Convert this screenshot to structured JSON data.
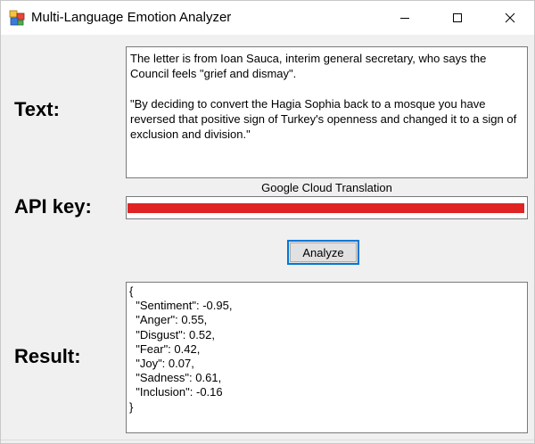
{
  "window": {
    "title": "Multi-Language Emotion Analyzer",
    "minimize_icon": "minimize-icon",
    "maximize_icon": "maximize-icon",
    "close_icon": "close-icon"
  },
  "labels": {
    "text": "Text:",
    "api_key": "API key:",
    "result": "Result:"
  },
  "input_text": {
    "value": "The letter is from Ioan Sauca, interim general secretary, who says the Council feels \"grief and dismay\".\n\n\"By deciding to convert the Hagia Sophia back to a mosque you have reversed that positive sign of Turkey's openness and changed it to a sign of exclusion and division.\""
  },
  "api": {
    "service_label": "Google Cloud Translation",
    "redaction_color": "#e02424"
  },
  "buttons": {
    "analyze": "Analyze"
  },
  "result": {
    "value": "{\n  \"Sentiment\": -0.95,\n  \"Anger\": 0.55,\n  \"Disgust\": 0.52,\n  \"Fear\": 0.42,\n  \"Joy\": 0.07,\n  \"Sadness\": 0.61,\n  \"Inclusion\": -0.16\n}"
  },
  "colors": {
    "accent": "#0078d7",
    "window_bg": "#f0f0f0"
  }
}
